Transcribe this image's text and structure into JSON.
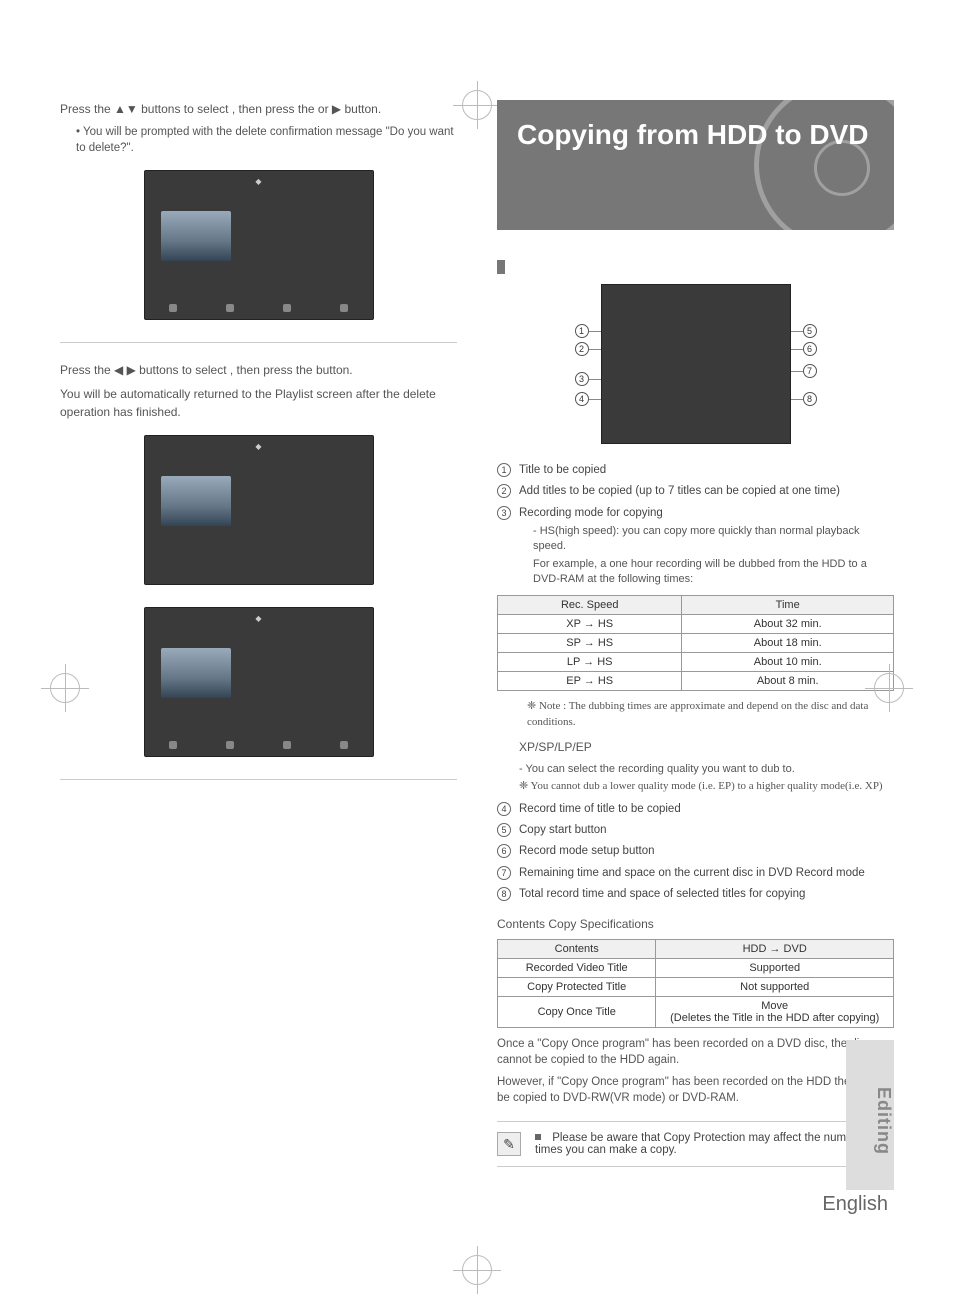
{
  "left": {
    "step6_a": "Press the ▲▼ buttons to select ",
    "step6_b": ", then press the ",
    "step6_c": " or ▶ button.",
    "step6_sub": "• You will be prompted with the delete confirmation message \"Do you want to delete?\".",
    "step7_a": "Press the ◀ ▶ buttons to select ",
    "step7_b": ", then press the ",
    "step7_c": " button.",
    "step7_body": "You will be automatically returned to the Playlist screen after the delete operation has finished."
  },
  "right": {
    "title": "Copying from HDD to DVD",
    "legend": [
      {
        "n": "①",
        "text": "Title to be copied"
      },
      {
        "n": "②",
        "text": "Add titles to be copied (up to 7 titles can be copied at one time)"
      },
      {
        "n": "③",
        "text": "Recording mode for copying",
        "sub": [
          "- HS(high speed): you can copy more quickly than normal playback speed.",
          "For example, a one hour recording will be dubbed from the HDD to a DVD-RAM at the following times:"
        ]
      }
    ],
    "speed_table": {
      "head": [
        "Rec. Speed",
        "Time"
      ],
      "rows": [
        [
          "XP → HS",
          "About 32 min."
        ],
        [
          "SP → HS",
          "About 18 min."
        ],
        [
          "LP → HS",
          "About 10 min."
        ],
        [
          "EP → HS",
          "About  8 min."
        ]
      ]
    },
    "note1": "❈ Note : The dubbing times are approximate and depend on the disc and data conditions.",
    "mode_head": "XP/SP/LP/EP",
    "mode_b1": "- You can select the recording quality you want to dub to.",
    "mode_b2": "❈ You cannot dub a lower quality mode (i.e. EP) to a higher quality mode(i.e. XP)",
    "legend2": [
      {
        "n": "④",
        "text": "Record time of title to be copied"
      },
      {
        "n": "⑤",
        "text": "Copy start button"
      },
      {
        "n": "⑥",
        "text": "Record mode setup button"
      },
      {
        "n": "⑦",
        "text": "Remaining time and space on the current disc in DVD Record mode"
      },
      {
        "n": "⑧",
        "text": "Total record time and space of selected titles for copying"
      }
    ],
    "spec_caption": "Contents Copy Specifications",
    "spec_table": {
      "head": [
        "Contents",
        "HDD → DVD"
      ],
      "rows": [
        [
          "Recorded Video Title",
          "Supported"
        ],
        [
          "Copy Protected Title",
          "Not supported"
        ],
        [
          "Copy Once Title",
          "Move\n(Deletes the Title in the HDD after copying)"
        ]
      ]
    },
    "para1": "Once a \"Copy Once program\" has been recorded on a DVD disc, the disc cannot be copied to the HDD again.",
    "para2": "However, if \"Copy Once program\" has been recorded on the HDD the title can be copied to DVD-RW(VR mode) or DVD-RAM.",
    "note_box": "Please be aware that Copy Protection may affect the number of times you can make a copy.",
    "footer": "English",
    "side_tab": "Editing"
  }
}
